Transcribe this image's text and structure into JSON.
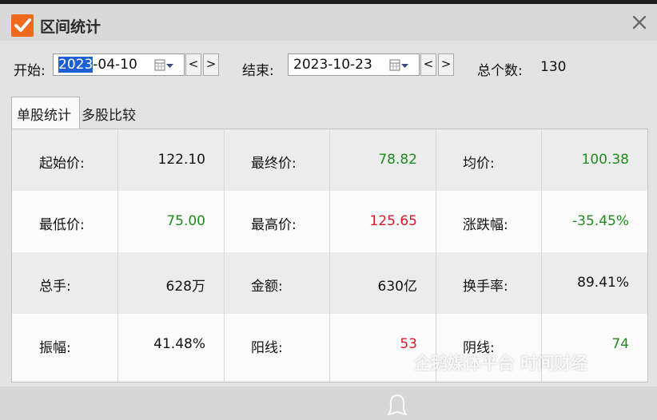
{
  "window": {
    "title": "区间统计"
  },
  "colors": {
    "accent": "#f06a1e",
    "green": "#1e8c1e",
    "red": "#e0162b",
    "black": "#111111"
  },
  "range": {
    "start_label": "开始:",
    "start_selected": "2023",
    "start_rest": "-04-10",
    "end_label": "结束:",
    "end_value": "2023-10-23",
    "prev": "<",
    "next": ">",
    "count_label": "总个数:",
    "count_value": "130"
  },
  "tabs": [
    {
      "label": "单股统计",
      "active": true
    },
    {
      "label": "多股比较",
      "active": false
    }
  ],
  "stats": [
    [
      {
        "label": "起始价:",
        "value": "122.10",
        "color": "black"
      },
      {
        "label": "最终价:",
        "value": "78.82",
        "color": "green"
      },
      {
        "label": "均价:",
        "value": "100.38",
        "color": "green"
      }
    ],
    [
      {
        "label": "最低价:",
        "value": "75.00",
        "color": "green"
      },
      {
        "label": "最高价:",
        "value": "125.65",
        "color": "red"
      },
      {
        "label": "涨跌幅:",
        "value": "-35.45%",
        "color": "green"
      }
    ],
    [
      {
        "label": "总手:",
        "value": "628万",
        "color": "black"
      },
      {
        "label": "金额:",
        "value": "630亿",
        "color": "black"
      },
      {
        "label": "换手率:",
        "value": "89.41%",
        "color": "black"
      }
    ],
    [
      {
        "label": "振幅:",
        "value": "41.48%",
        "color": "black"
      },
      {
        "label": "阳线:",
        "value": "53",
        "color": "red"
      },
      {
        "label": "阴线:",
        "value": "74",
        "color": "green"
      }
    ]
  ],
  "watermark": "企鹅媒体平台 时间财经"
}
